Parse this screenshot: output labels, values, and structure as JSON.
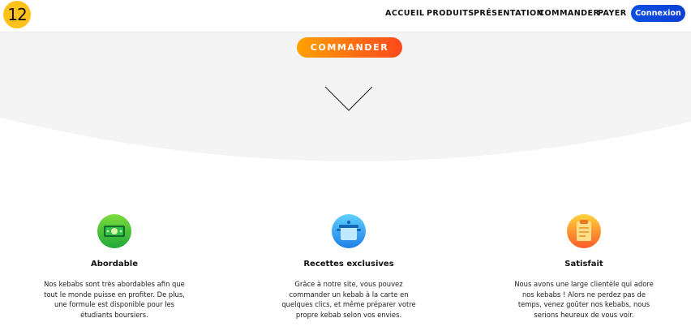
{
  "header": {
    "logo_text": "12",
    "nav": {
      "accueil": "ACCUEIL",
      "produits": "PRODUITS",
      "presentation": "PRÉSENTATION",
      "commander": "COMMANDER",
      "payer": "PAYER"
    },
    "login_label": "Connexion"
  },
  "hero": {
    "cta_label": "COMMANDER",
    "arrow_icon": "chevron-down-icon"
  },
  "features": [
    {
      "icon": "money-icon",
      "title": "Abordable",
      "text": "Nos kebabs sont très abordables afin que tout le monde puisse en profiter. De plus, une formule est disponible pour les étudiants boursiers."
    },
    {
      "icon": "cooking-pot-icon",
      "title": "Recettes exclusives",
      "text": "Grâce à notre site, vous pouvez commander un kebab à la carte en quelques clics, et même préparer votre propre kebab selon vos envies."
    },
    {
      "icon": "clipboard-icon",
      "title": "Satisfait",
      "text": "Nous avons une large clientèle qui adore nos kebabs ! Alors ne perdez pas de temps, venez goûter nos kebabs, nous serions heureux de vous voir."
    }
  ],
  "colors": {
    "accent_blue": "#0a4fe0",
    "cta_start": "#ffa200",
    "cta_end": "#ff4a1c",
    "logo_yellow": "#ffc21a",
    "hero_bg": "#f4f4f4"
  }
}
